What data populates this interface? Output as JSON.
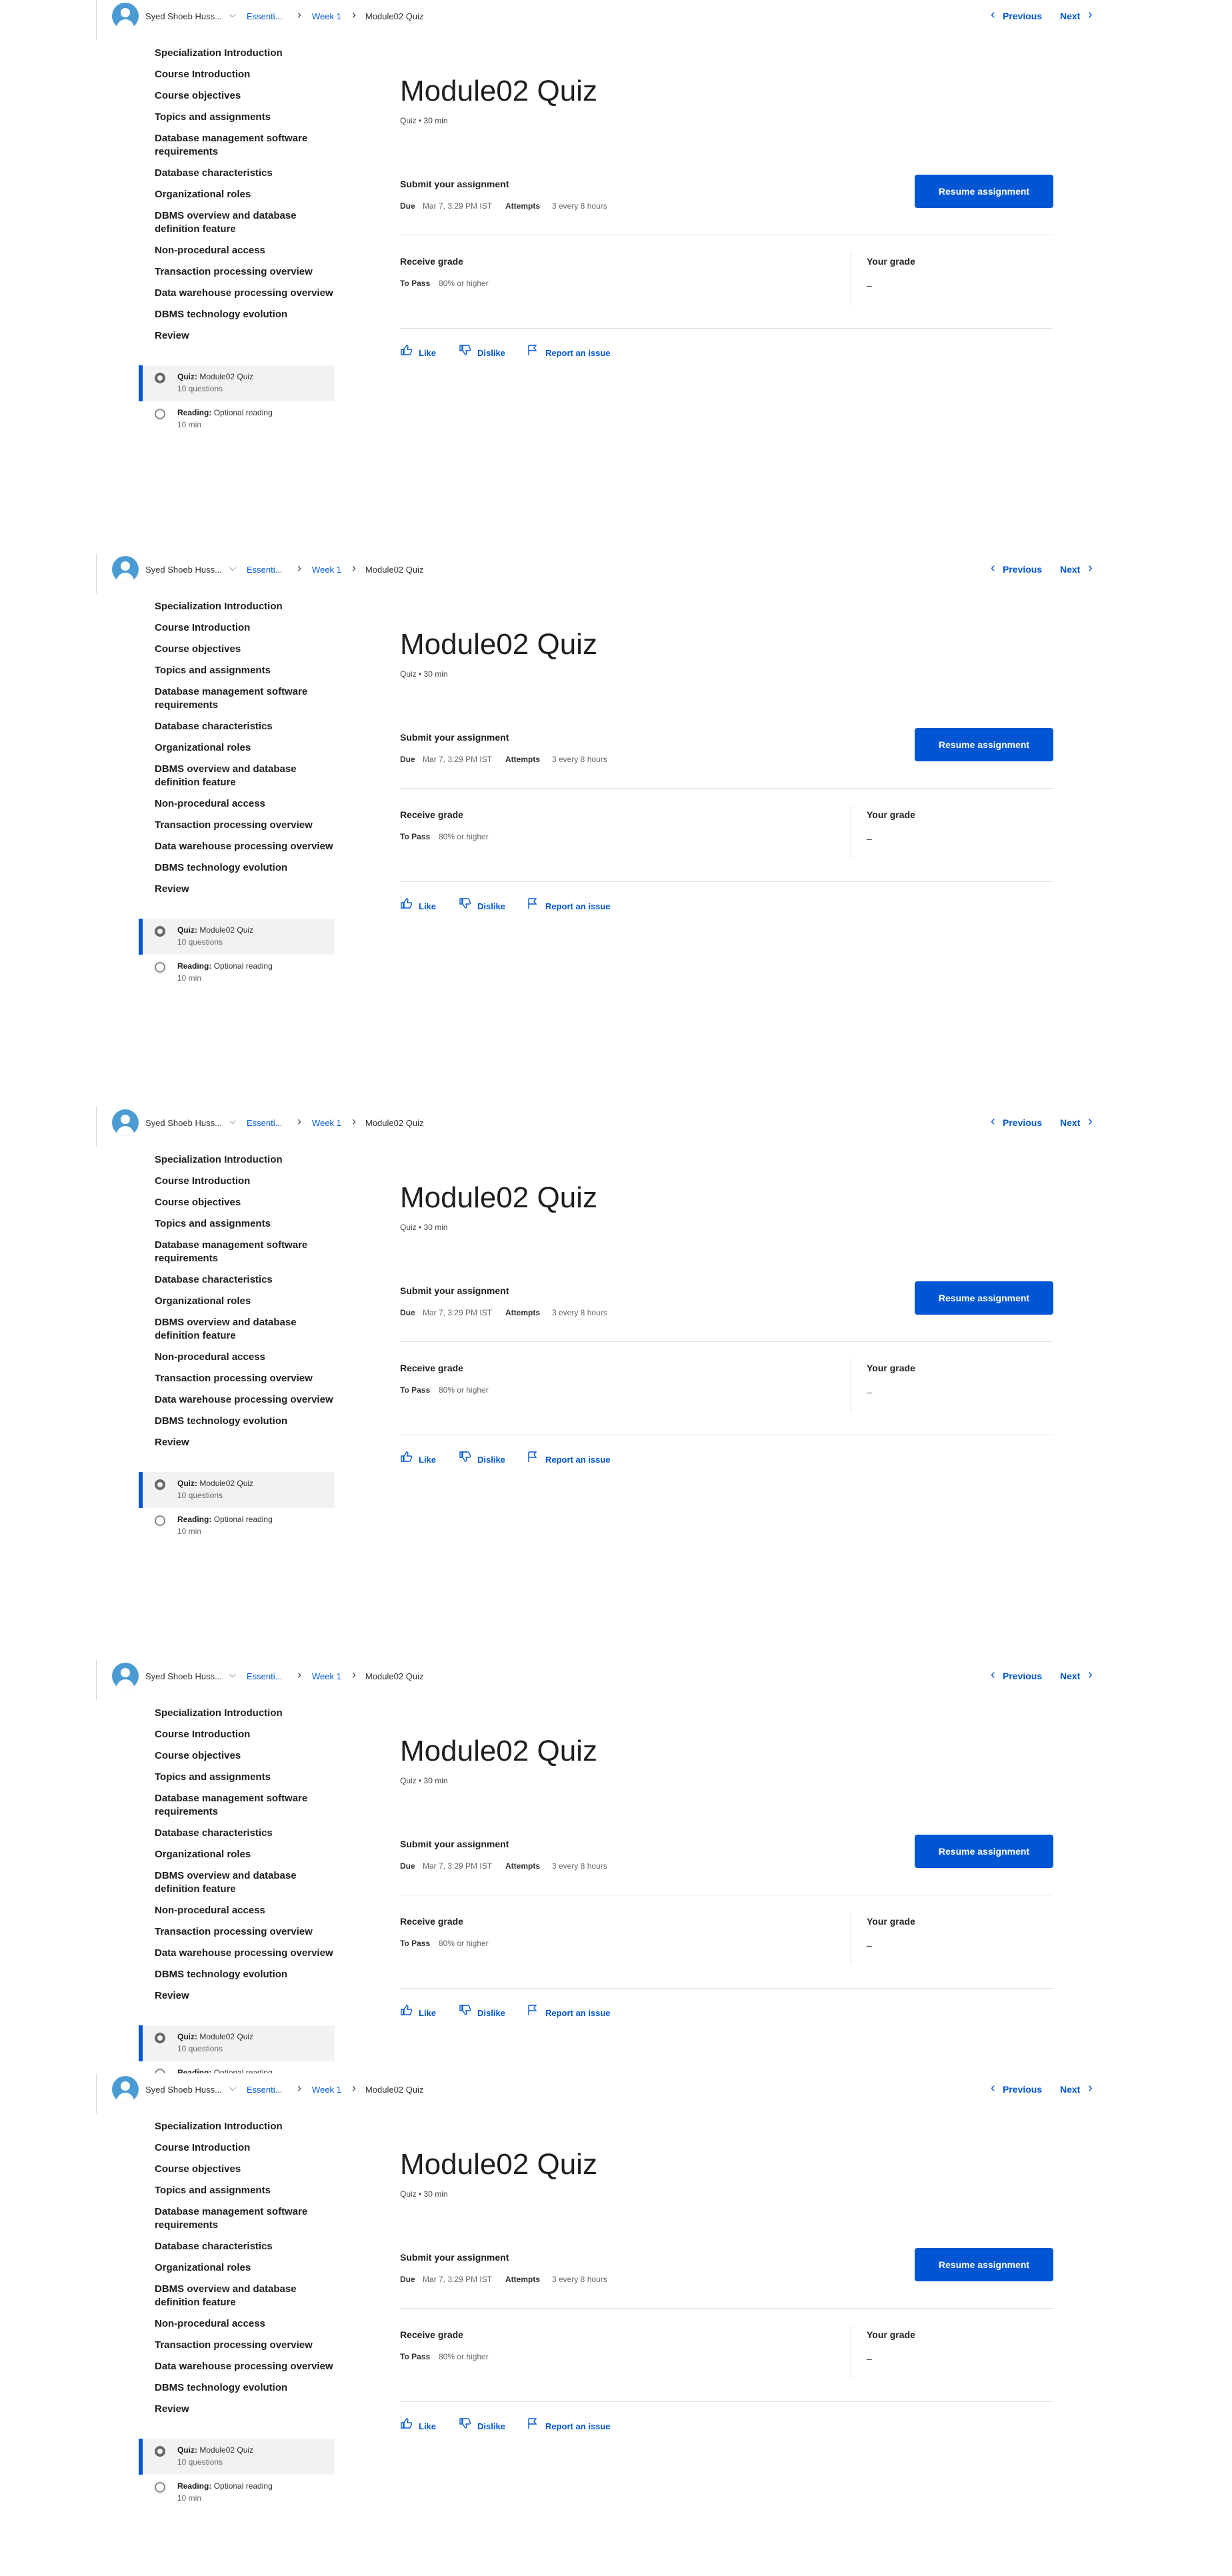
{
  "header": {
    "user_name": "Syed Shoeb Huss...",
    "breadcrumbs": [
      "Essenti...",
      "Week 1",
      "Module02 Quiz"
    ],
    "previous_label": "Previous",
    "next_label": "Next"
  },
  "sidebar": {
    "items": [
      "Specialization Introduction",
      "Course Introduction",
      "Course objectives",
      "Topics and assignments",
      "Database management software requirements",
      "Database characteristics",
      "Organizational roles",
      "DBMS overview and database definition feature",
      "Non-procedural access",
      "Transaction processing overview",
      "Data warehouse processing overview",
      "DBMS technology evolution",
      "Review"
    ],
    "sub_items": [
      {
        "type_label": "Quiz:",
        "title": "Module02 Quiz",
        "meta": "10 questions",
        "icon": "quiz-icon",
        "active": true
      },
      {
        "type_label": "Reading:",
        "title": "Optional reading",
        "meta": "10 min",
        "icon": "reading-icon",
        "active": false
      }
    ]
  },
  "main": {
    "title": "Module02 Quiz",
    "meta": "Quiz • 30 min",
    "submit_heading": "Submit your assignment",
    "due_label": "Due",
    "due_value": "Mar 7, 3:29 PM IST",
    "attempts_label": "Attempts",
    "attempts_value": "3 every 8 hours",
    "resume_label": "Resume assignment",
    "receive_grade_heading": "Receive grade",
    "to_pass_label": "To Pass",
    "to_pass_value": "80% or higher",
    "your_grade_heading": "Your grade",
    "your_grade_value": "–",
    "like_label": "Like",
    "dislike_label": "Dislike",
    "report_label": "Report an issue"
  },
  "colors": {
    "accent": "#0056d2",
    "avatar": "#4a9bd4"
  }
}
